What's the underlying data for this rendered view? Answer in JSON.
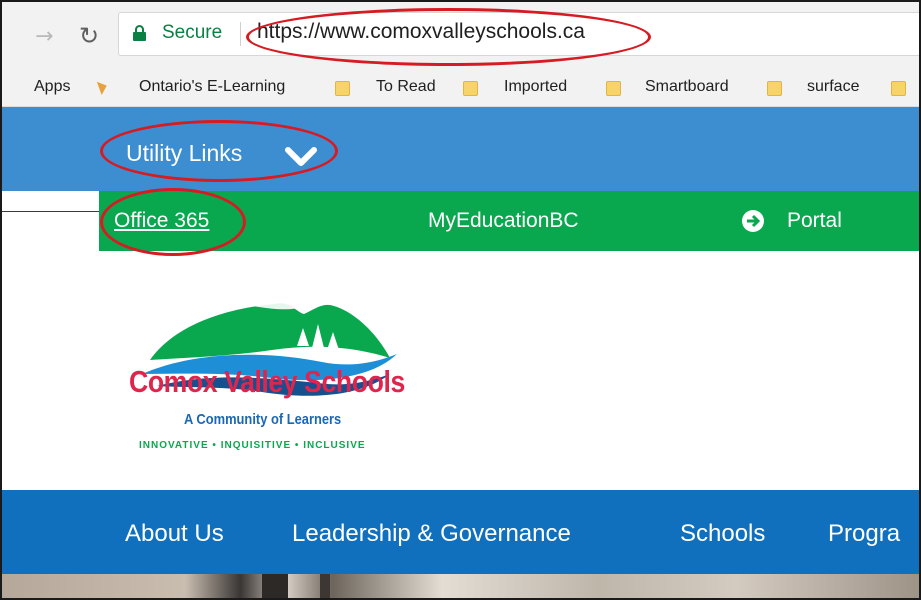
{
  "browser": {
    "back_icon": "arrow-right-icon",
    "reload_icon": "reload-icon",
    "security_label": "Secure",
    "url": "https://www.comoxvalleyschools.ca"
  },
  "bookmarks": {
    "apps": "Apps",
    "items": [
      "Ontario's E-Learning",
      "To Read",
      "Imported",
      "Smartboard",
      "surface"
    ]
  },
  "site": {
    "utility_links": "Utility Links",
    "green_links": [
      "Office 365",
      "MyEducationBC",
      "Portal"
    ],
    "brand": "Comox Valley Schools",
    "tagline": "A Community of Learners",
    "values": "INNOVATIVE • INQUISITIVE • INCLUSIVE",
    "main_nav": [
      "About Us",
      "Leadership & Governance",
      "Schools",
      "Progra"
    ]
  },
  "colors": {
    "utility_bar": "#3d8ed0",
    "green_bar": "#0aa84e",
    "main_nav": "#1170bd",
    "brand_red": "#e0254d",
    "annotation_red": "#d61b23"
  }
}
